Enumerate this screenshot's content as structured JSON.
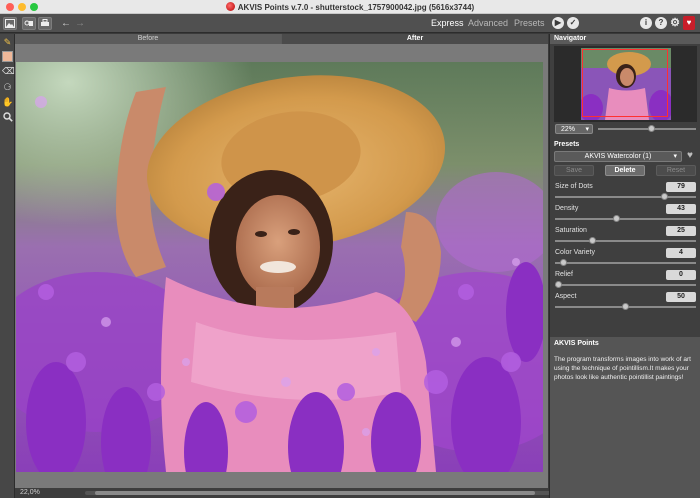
{
  "window": {
    "title": "AKVIS Points v.7.0 - shutterstock_1757900042.jpg (5616x3744)"
  },
  "toolbar": {
    "modes": [
      {
        "label": "Express",
        "active": true
      },
      {
        "label": "Advanced",
        "active": false
      },
      {
        "label": "Presets",
        "active": false
      }
    ],
    "icons": [
      "open-image-icon",
      "save-image-icon",
      "print-icon",
      "undo-icon",
      "redo-icon",
      "run-icon",
      "apply-icon",
      "info-icon",
      "help-icon",
      "settings-icon",
      "akvis-logo-icon"
    ]
  },
  "canvas": {
    "tabs": [
      {
        "label": "Before",
        "active": false
      },
      {
        "label": "After",
        "active": true
      }
    ],
    "zoom_status": "22,0%"
  },
  "navigator": {
    "title": "Navigator",
    "zoom": "22%",
    "zoom_level": 0.55
  },
  "presets": {
    "label": "Presets",
    "selected": "AKVIS Watercolor (1)",
    "buttons": {
      "save": "Save",
      "delete": "Delete",
      "reset": "Reset"
    }
  },
  "params": [
    {
      "label": "Size of Dots",
      "value": "79",
      "level": 0.79
    },
    {
      "label": "Density",
      "value": "43",
      "level": 0.43
    },
    {
      "label": "Saturation",
      "value": "25",
      "level": 0.25
    },
    {
      "label": "Color Variety",
      "value": "4",
      "level": 0.04
    },
    {
      "label": "Relief",
      "value": "0",
      "level": 0.0
    },
    {
      "label": "Aspect",
      "value": "50",
      "level": 0.5
    }
  ],
  "info": {
    "title": "AKVIS Points",
    "text": "The program transforms images into work of art using the technique of pointillism.It makes your photos look like authentic pointillist paintings!"
  },
  "colors": {
    "panel": "#3f3f3f",
    "accent_red": "#c81e2a",
    "swatch": "#f0b899"
  }
}
